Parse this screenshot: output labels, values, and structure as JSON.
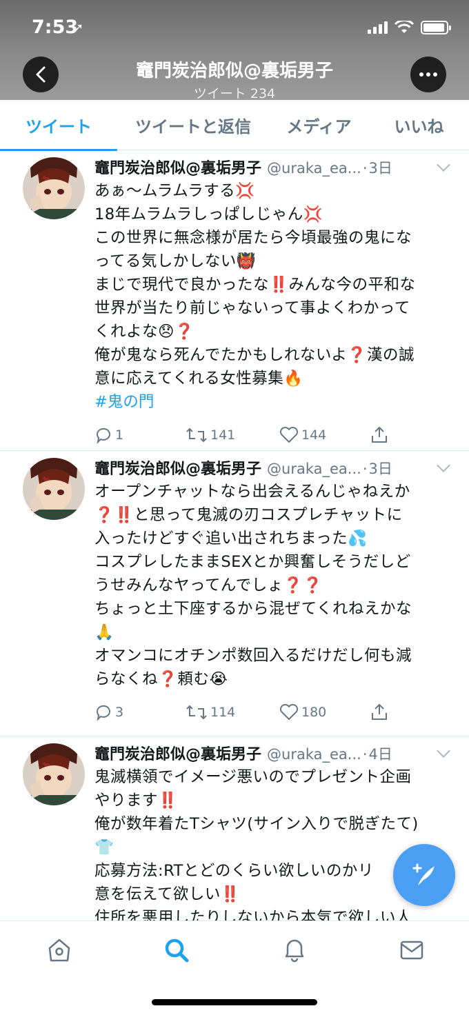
{
  "status": {
    "time": "7:53"
  },
  "header": {
    "title": "竈門炭治郎似@裏垢男子",
    "subtitle": "ツイート 234"
  },
  "tabs": [
    {
      "label": "ツイート",
      "active": true
    },
    {
      "label": "ツイートと返信",
      "active": false
    },
    {
      "label": "メディア",
      "active": false
    },
    {
      "label": "いいね",
      "active": false
    }
  ],
  "tweets": [
    {
      "name": "竈門炭治郎似@裏垢男子",
      "handle": "@uraka_ea...",
      "time": "3日",
      "body": "あぁ〜ムラムラする💢\n18年ムラムラしっぱしじゃん💢\nこの世界に無念様が居たら今頃最強の鬼にな\nってる気しかしない👹\nまじで現代で良かったな‼️みんな今の平和な\n世界が当たり前じゃないって事よくわかって\nくれよな😞❓\n俺が鬼なら死んでたかもしれないよ❓漢の誠\n意に応えてくれる女性募集🔥",
      "hashtag": "#鬼の門",
      "replies": "1",
      "retweets": "141",
      "likes": "144"
    },
    {
      "name": "竈門炭治郎似@裏垢男子",
      "handle": "@uraka_ea...",
      "time": "3日",
      "body": "オープンチャットなら出会えるんじゃねえか\n❓‼️と思って鬼滅の刃コスプレチャットに\n入ったけどすぐ追い出されちまった💦\nコスプレしたままSEXとか興奮しそうだしど\nうせみんなヤってんでしょ❓❓\nちょっと土下座するから混ぜてくれねえかな\n🙏\nオマンコにオチンポ数回入るだけだし何も減\nらなくね❓頼む😭",
      "hashtag": "",
      "replies": "3",
      "retweets": "114",
      "likes": "180"
    },
    {
      "name": "竈門炭治郎似@裏垢男子",
      "handle": "@uraka_ea...",
      "time": "4日",
      "body": "鬼滅横領でイメージ悪いのでプレゼント企画\nやります‼️\n俺が数年着たTシャツ(サイン入りで脱ぎたて)\n👕\n応募方法:RTとどのくらい欲しいのかリ\n意を伝えて欲しい‼️\n住所を悪用したりしないから本気で欲しい人",
      "hashtag": "",
      "replies": "",
      "retweets": "",
      "likes": ""
    }
  ],
  "icons": {
    "back": "chevron-left-icon",
    "more": "more-icon",
    "compose": "compose-tweet-icon",
    "nav": [
      "home-icon",
      "search-icon",
      "notifications-icon",
      "messages-icon"
    ]
  },
  "colors": {
    "accent": "#1da1f2",
    "secondary": "#657786"
  }
}
